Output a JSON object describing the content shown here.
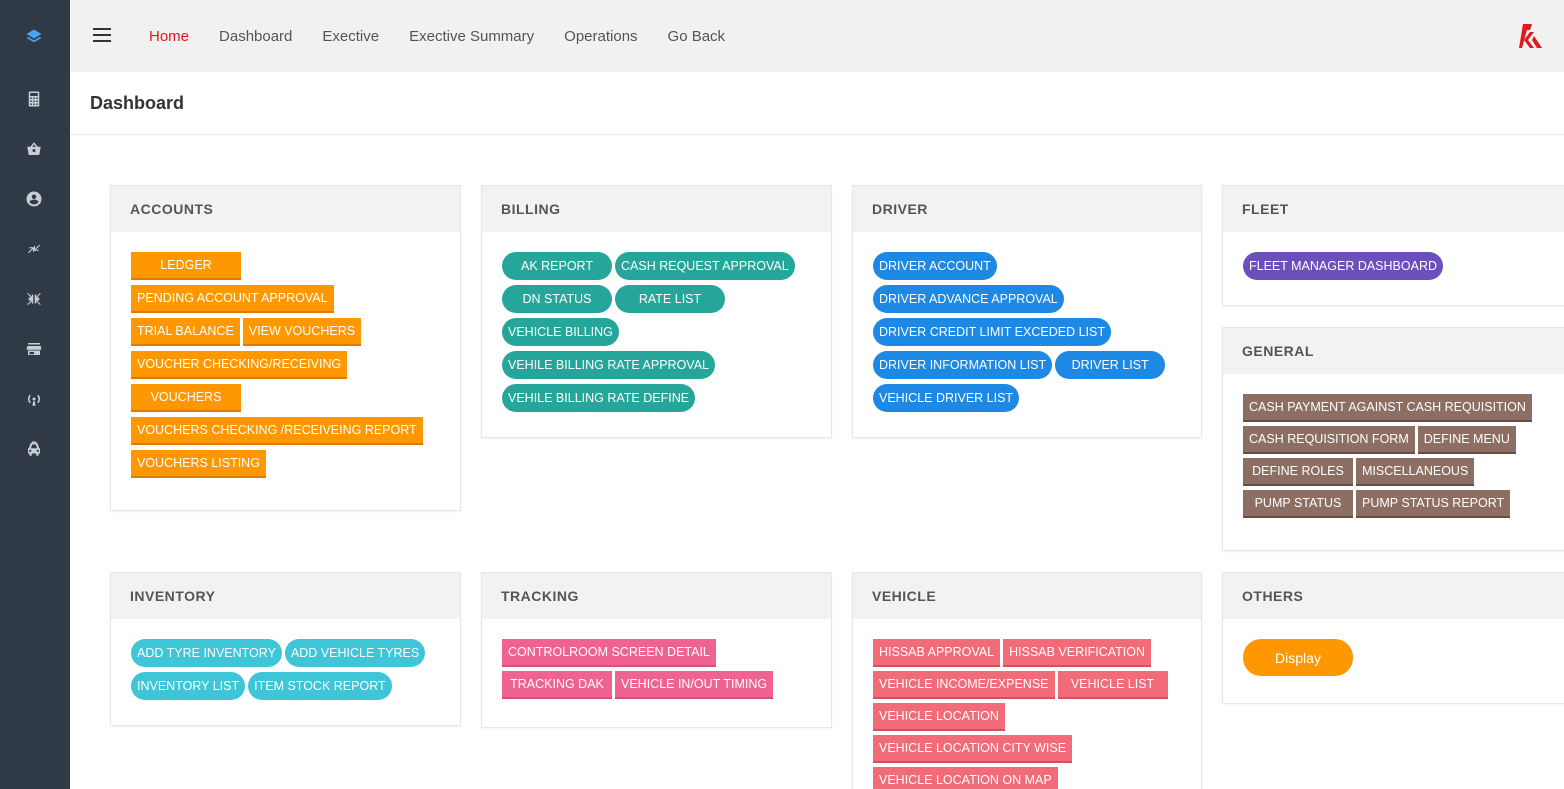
{
  "nav": {
    "items": [
      "Home",
      "Dashboard",
      "Exective",
      "Exective Summary",
      "Operations",
      "Go Back"
    ]
  },
  "page": {
    "title": "Dashboard"
  },
  "colors": {
    "sidebar": "#2f3a46",
    "accent_active": "#e0191f",
    "orange": "#ff9800",
    "teal": "#26a69a",
    "blue": "#1e88e5",
    "purple": "#6b4fbb",
    "brown": "#8d6e63",
    "cyan": "#3ec6d8",
    "pink": "#f06292",
    "red": "#f26b78"
  },
  "sidebar": {
    "icons": [
      "layers-icon",
      "calculator-icon",
      "basket-icon",
      "account-circle-icon",
      "compress-icon",
      "collapse-icon",
      "store-icon",
      "broadcast-icon",
      "taxi-icon"
    ]
  },
  "cards": {
    "accounts": {
      "title": "ACCOUNTS",
      "buttons": [
        "LEDGER",
        "PENDING ACCOUNT APPROVAL",
        "TRIAL BALANCE",
        "VIEW VOUCHERS",
        "VOUCHER CHECKING/RECEIVING",
        "VOUCHERS",
        "VOUCHERS CHECKING /RECEIVEING REPORT",
        "VOUCHERS LISTING"
      ]
    },
    "billing": {
      "title": "BILLING",
      "buttons": [
        "AK REPORT",
        "CASH REQUEST APPROVAL",
        "DN STATUS",
        "RATE LIST",
        "VEHICLE BILLING",
        "VEHILE BILLING RATE APPROVAL",
        "VEHILE BILLING RATE DEFINE"
      ]
    },
    "driver": {
      "title": "DRIVER",
      "buttons": [
        "DRIVER ACCOUNT",
        "DRIVER ADVANCE APPROVAL",
        "DRIVER CREDIT LIMIT EXCEDED LIST",
        "DRIVER INFORMATION LIST",
        "DRIVER LIST",
        "VEHICLE DRIVER LIST"
      ]
    },
    "fleet": {
      "title": "FLEET",
      "buttons": [
        "FLEET MANAGER DASHBOARD"
      ]
    },
    "general": {
      "title": "GENERAL",
      "buttons": [
        "CASH PAYMENT AGAINST CASH REQUISITION",
        "CASH REQUISITION FORM",
        "DEFINE MENU",
        "DEFINE ROLES",
        "MISCELLANEOUS",
        "PUMP STATUS",
        "PUMP STATUS REPORT"
      ]
    },
    "inventory": {
      "title": "INVENTORY",
      "buttons": [
        "ADD TYRE INVENTORY",
        "ADD VEHICLE TYRES",
        "INVENTORY LIST",
        "ITEM STOCK REPORT"
      ]
    },
    "tracking": {
      "title": "TRACKING",
      "buttons": [
        "CONTROLROOM SCREEN DETAIL",
        "TRACKING DAK",
        "VEHICLE IN/OUT TIMING"
      ]
    },
    "vehicle": {
      "title": "VEHICLE",
      "buttons": [
        "HISSAB APPROVAL",
        "HISSAB VERIFICATION",
        "VEHICLE INCOME/EXPENSE",
        "VEHICLE LIST",
        "VEHICLE LOCATION",
        "VEHICLE LOCATION CITY WISE",
        "VEHICLE LOCATION ON MAP"
      ]
    },
    "others": {
      "title": "OTHERS",
      "buttons": [
        "Display"
      ]
    }
  }
}
